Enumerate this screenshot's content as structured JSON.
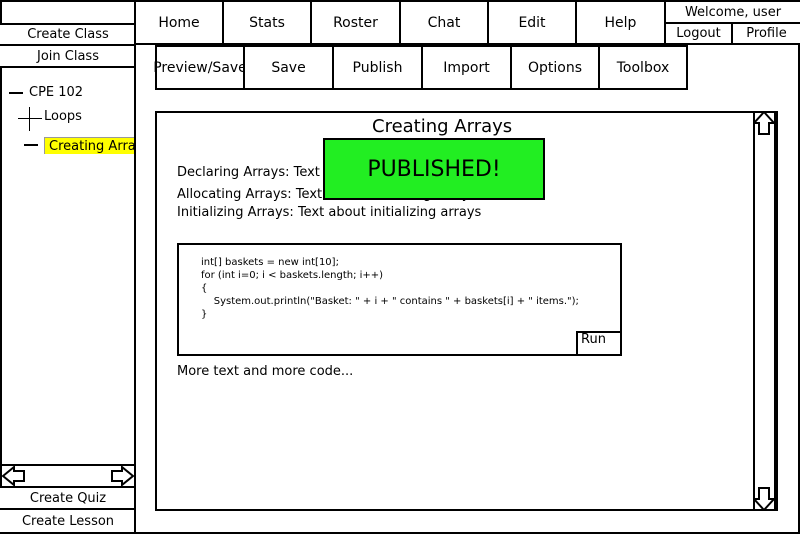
{
  "left_panel": {
    "create_class": "Create Class",
    "join_class": "Join Class",
    "tree": {
      "course": "CPE 102",
      "folder": "Loops",
      "selected_item": "Creating Arrays"
    },
    "create_quiz": "Create Quiz",
    "create_lesson": "Create Lesson"
  },
  "nav": {
    "tabs": [
      "Home",
      "Stats",
      "Roster",
      "Chat",
      "Edit",
      "Help"
    ]
  },
  "user": {
    "welcome": "Welcome, user",
    "logout": "Logout",
    "profile": "Profile"
  },
  "toolbar": {
    "buttons": [
      "Preview/Save",
      "Save",
      "Publish",
      "Import",
      "Options",
      "Toolbox"
    ]
  },
  "content": {
    "title": "Creating Arrays",
    "lines": [
      "Declaring Arrays: Text about declaring arrays",
      "Allocating Arrays: Text about allocating arrays",
      "Initializing Arrays: Text about initializing arrays"
    ],
    "code": [
      "int[] baskets = new int[10];",
      "for (int i=0; i < baskets.length; i++)",
      "{",
      "    System.out.println(\"Basket: \" + i + \" contains \" + baskets[i] + \" items.\");",
      "}"
    ],
    "run_label": "Run",
    "more_text": "More text and more code..."
  },
  "notification": {
    "text": "PUBLISHED!",
    "color": "#22ee22"
  },
  "colors": {
    "selected_highlight": "#ffff00"
  }
}
